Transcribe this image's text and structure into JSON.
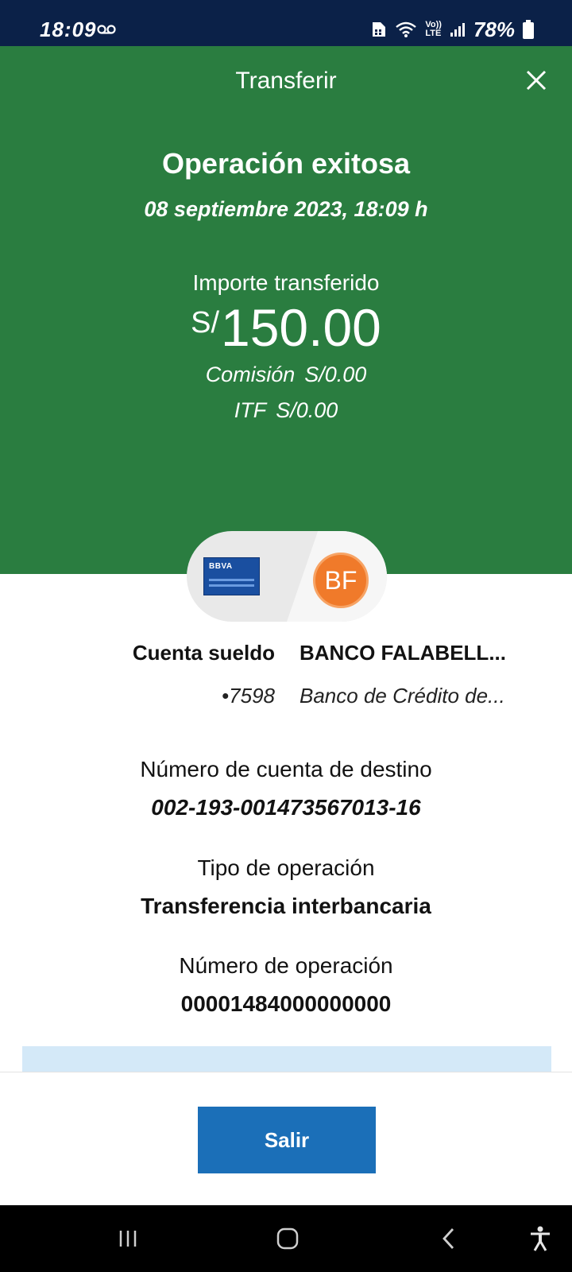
{
  "status_bar": {
    "time": "18:09",
    "battery": "78%",
    "icons": [
      "voicemail-icon",
      "sim-icon",
      "wifi-icon",
      "volte-icon",
      "signal-icon",
      "battery-icon"
    ],
    "volte_top": "Vo))",
    "volte_bottom": "LTE"
  },
  "header": {
    "title": "Transferir",
    "close_icon": "close-icon"
  },
  "result": {
    "title": "Operación exitosa",
    "date": "08 septiembre 2023, 18:09 h",
    "amount_label": "Importe transferido",
    "currency": "S/",
    "amount": "150.00",
    "commission_label": "Comisión",
    "commission_value": "S/0.00",
    "itf_label": "ITF",
    "itf_value": "S/0.00"
  },
  "transfer": {
    "origin_logo": "BBVA",
    "destination_initials": "BF",
    "origin_account": "Cuenta sueldo",
    "origin_number": "•7598",
    "destination_name": "BANCO FALABELL...",
    "destination_bank": "Banco de Crédito de..."
  },
  "details": {
    "account_label": "Número de cuenta de destino",
    "account_value": "002-193-001473567013-16",
    "type_label": "Tipo de operación",
    "type_value": "Transferencia interbancaria",
    "operation_label": "Número de operación",
    "operation_value": "00001484000000000"
  },
  "footer": {
    "exit_label": "Salir"
  },
  "nav_bar": {
    "icons": [
      "recent-apps-icon",
      "home-icon",
      "back-icon",
      "accessibility-icon"
    ]
  },
  "colors": {
    "status_bar": "#0b2148",
    "header_green": "#2a7d40",
    "button_blue": "#1b6fb8",
    "bank_orange": "#f07a2a",
    "info_strip": "#d4e9f8"
  }
}
